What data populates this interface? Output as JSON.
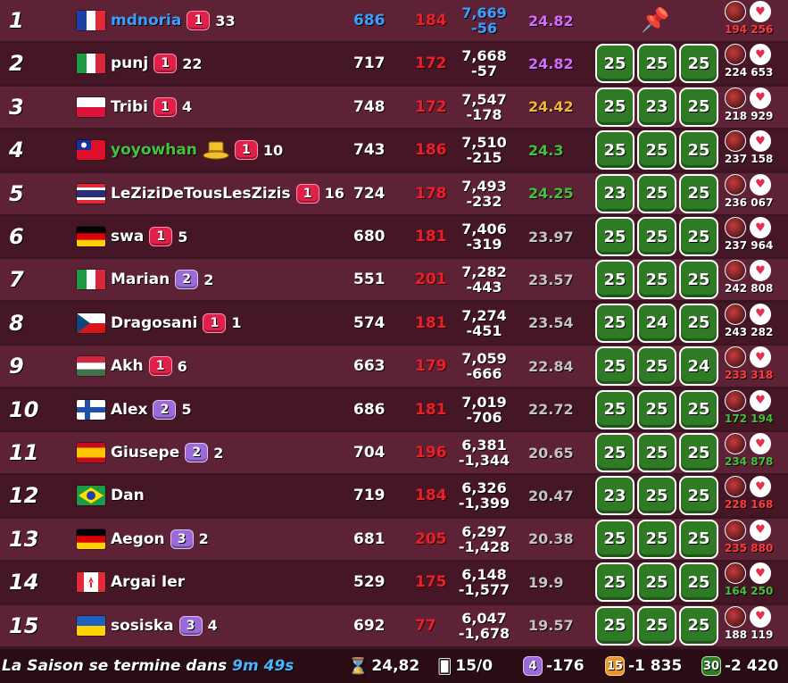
{
  "colors": {
    "rank1_name": "#3aa0ff",
    "top_avg": "#d66bff",
    "third_avg": "#f2b630",
    "green": "#44c23a",
    "grey": "#c8c2c2"
  },
  "rows": [
    {
      "rank": "1",
      "flag": "fr",
      "name": "mdnoria",
      "name_color": "#3aa0ff",
      "badge": "1",
      "badge_type": "red",
      "trophies": "33",
      "v1": "686",
      "v1_color": "#3aa0ff",
      "v2": "184",
      "score": "7,669",
      "diff": "-56",
      "score_color": "#3aa0ff",
      "avg": "24.82",
      "avg_color": "#d66bff",
      "levels": [],
      "pin": "📌",
      "extra_top": "",
      "n1": "194",
      "n2": "256",
      "n_color": "#ff3b3b"
    },
    {
      "rank": "2",
      "flag": "it",
      "name": "punj",
      "name_color": "#ffffff",
      "badge": "1",
      "badge_type": "red",
      "trophies": "22",
      "v1": "717",
      "v2": "172",
      "score": "7,668",
      "diff": "-57",
      "avg": "24.82",
      "avg_color": "#d66bff",
      "levels": [
        "25",
        "25",
        "25"
      ],
      "n1": "224",
      "n2": "653",
      "n_color": "#ffffff"
    },
    {
      "rank": "3",
      "flag": "pl",
      "name": "Tribi",
      "name_color": "#ffffff",
      "badge": "1",
      "badge_type": "red",
      "trophies": "4",
      "v1": "748",
      "v2": "172",
      "score": "7,547",
      "diff": "-178",
      "avg": "24.42",
      "avg_color": "#f2b630",
      "levels": [
        "25",
        "23",
        "25"
      ],
      "n1": "218",
      "n2": "929",
      "n_color": "#ffffff"
    },
    {
      "rank": "4",
      "flag": "tw",
      "name": "yoyowhan",
      "name_color": "#44c23a",
      "hat": true,
      "badge": "1",
      "badge_type": "red",
      "trophies": "10",
      "v1": "743",
      "v2": "186",
      "score": "7,510",
      "diff": "-215",
      "avg": "24.3",
      "avg_color": "#44c23a",
      "levels": [
        "25",
        "25",
        "25"
      ],
      "n1": "237",
      "n2": "158",
      "n_color": "#ffffff"
    },
    {
      "rank": "5",
      "flag": "th",
      "name": "LeZiziDeTousLesZizis",
      "name_color": "#ffffff",
      "badge": "1",
      "badge_type": "red",
      "trophies": "16",
      "v1": "724",
      "v2": "178",
      "score": "7,493",
      "diff": "-232",
      "avg": "24.25",
      "avg_color": "#44c23a",
      "levels": [
        "23",
        "25",
        "25"
      ],
      "n1": "236",
      "n2": "067",
      "n_color": "#ffffff"
    },
    {
      "rank": "6",
      "flag": "de",
      "name": "swa",
      "name_color": "#ffffff",
      "badge": "1",
      "badge_type": "red",
      "trophies": "5",
      "v1": "680",
      "v2": "181",
      "score": "7,406",
      "diff": "-319",
      "avg": "23.97",
      "avg_color": "#c8c2c2",
      "levels": [
        "25",
        "25",
        "25"
      ],
      "n1": "237",
      "n2": "964",
      "n_color": "#ffffff"
    },
    {
      "rank": "7",
      "flag": "it",
      "name": "Marian",
      "name_color": "#ffffff",
      "badge": "2",
      "badge_type": "purple",
      "trophies": "2",
      "v1": "551",
      "v2": "201",
      "score": "7,282",
      "diff": "-443",
      "avg": "23.57",
      "avg_color": "#c8c2c2",
      "levels": [
        "25",
        "25",
        "25"
      ],
      "n1": "242",
      "n2": "808",
      "n_color": "#ffffff"
    },
    {
      "rank": "8",
      "flag": "cz",
      "name": "Dragosani",
      "name_color": "#ffffff",
      "badge": "1",
      "badge_type": "red",
      "trophies": "1",
      "v1": "574",
      "v2": "181",
      "score": "7,274",
      "diff": "-451",
      "avg": "23.54",
      "avg_color": "#c8c2c2",
      "levels": [
        "25",
        "24",
        "25"
      ],
      "n1": "243",
      "n2": "282",
      "n_color": "#ffffff"
    },
    {
      "rank": "9",
      "flag": "hu",
      "name": "Akh",
      "name_color": "#ffffff",
      "badge": "1",
      "badge_type": "red",
      "trophies": "6",
      "v1": "663",
      "v2": "179",
      "score": "7,059",
      "diff": "-666",
      "avg": "22.84",
      "avg_color": "#c8c2c2",
      "levels": [
        "25",
        "25",
        "24"
      ],
      "n1": "233",
      "n2": "318",
      "n_color": "#ff3b3b"
    },
    {
      "rank": "10",
      "flag": "fi",
      "name": "Alex",
      "name_color": "#ffffff",
      "badge": "2",
      "badge_type": "purple",
      "trophies": "5",
      "v1": "686",
      "v2": "181",
      "score": "7,019",
      "diff": "-706",
      "avg": "22.72",
      "avg_color": "#c8c2c2",
      "levels": [
        "25",
        "25",
        "25"
      ],
      "n1": "172",
      "n2": "194",
      "n_color": "#44c23a"
    },
    {
      "rank": "11",
      "flag": "es",
      "name": "Giusepe",
      "name_color": "#ffffff",
      "badge": "2",
      "badge_type": "purple",
      "trophies": "2",
      "v1": "704",
      "v2": "196",
      "score": "6,381",
      "diff": "-1,344",
      "avg": "20.65",
      "avg_color": "#c8c2c2",
      "levels": [
        "25",
        "25",
        "25"
      ],
      "n1": "234",
      "n2": "878",
      "n_color": "#44c23a"
    },
    {
      "rank": "12",
      "flag": "br",
      "name": "Dan",
      "name_color": "#ffffff",
      "badge": "",
      "badge_type": "",
      "trophies": "",
      "v1": "719",
      "v2": "184",
      "score": "6,326",
      "diff": "-1,399",
      "avg": "20.47",
      "avg_color": "#c8c2c2",
      "levels": [
        "23",
        "25",
        "25"
      ],
      "n1": "228",
      "n2": "168",
      "n_color": "#ff3b3b"
    },
    {
      "rank": "13",
      "flag": "de",
      "name": "Aegon",
      "name_color": "#ffffff",
      "badge": "3",
      "badge_type": "purple",
      "trophies": "2",
      "v1": "681",
      "v2": "205",
      "score": "6,297",
      "diff": "-1,428",
      "avg": "20.38",
      "avg_color": "#c8c2c2",
      "levels": [
        "25",
        "25",
        "25"
      ],
      "n1": "235",
      "n2": "880",
      "n_color": "#ff3b3b"
    },
    {
      "rank": "14",
      "flag": "ca",
      "name": "Argai Ier",
      "name_color": "#ffffff",
      "badge": "",
      "badge_type": "",
      "trophies": "",
      "v1": "529",
      "v2": "175",
      "score": "6,148",
      "diff": "-1,577",
      "avg": "19.9",
      "avg_color": "#c8c2c2",
      "levels": [
        "25",
        "25",
        "25"
      ],
      "n1": "164",
      "n2": "250",
      "n_color": "#44c23a"
    },
    {
      "rank": "15",
      "flag": "ua",
      "name": "sosiska",
      "name_color": "#ffffff",
      "badge": "3",
      "badge_type": "purple",
      "trophies": "4",
      "v1": "692",
      "v2": "77",
      "score": "6,047",
      "diff": "-1,678",
      "avg": "19.57",
      "avg_color": "#c8c2c2",
      "levels": [
        "25",
        "25",
        "25"
      ],
      "n1": "188",
      "n2": "119",
      "n_color": "#ffffff"
    }
  ],
  "footer": {
    "ends_label": "La Saison se termine dans",
    "timer": "9m 49s",
    "stat1_value": "24,82",
    "stat2_value": "15/0",
    "stat3_badge": "4",
    "stat3_value": "-176",
    "stat4_badge": "15",
    "stat4_value": "-1 835",
    "stat5_badge": "30",
    "stat5_value": "-2 420"
  }
}
